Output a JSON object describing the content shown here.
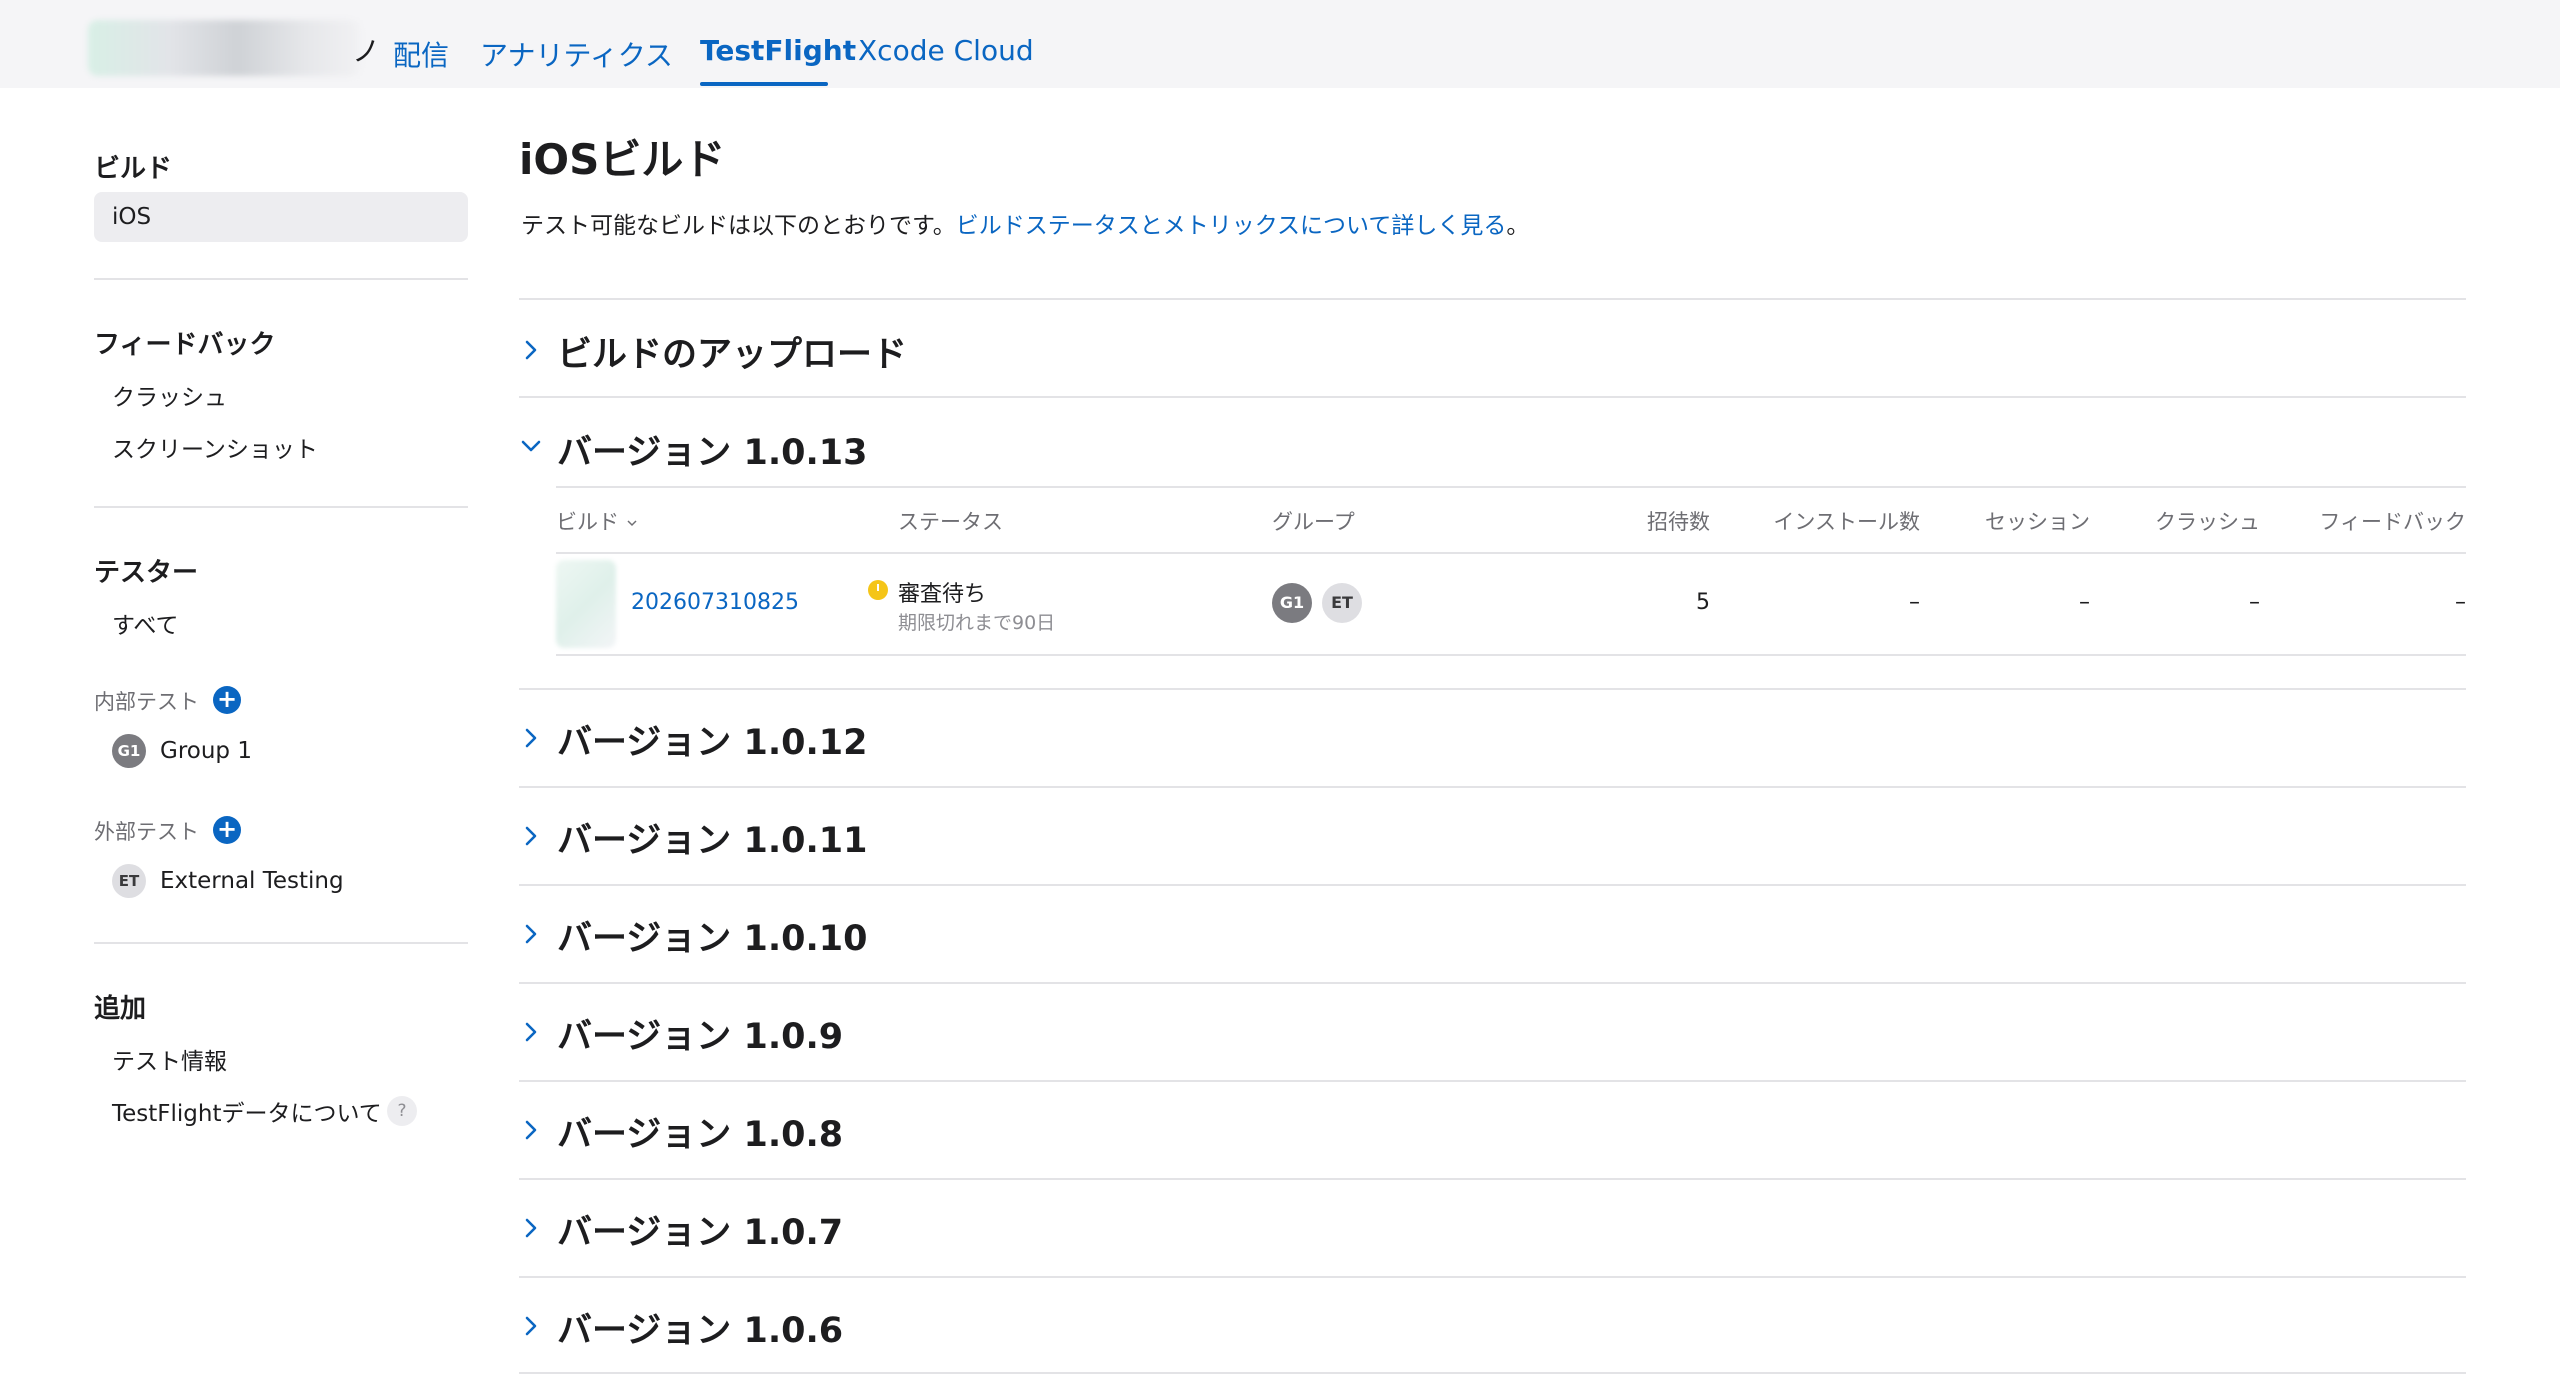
{
  "topnav": {
    "app_name_tail": "ノ",
    "tabs": [
      {
        "label": "配信"
      },
      {
        "label": "アナリティクス"
      },
      {
        "label": "TestFlight"
      },
      {
        "label": "Xcode Cloud"
      }
    ],
    "active_tab": "TestFlight"
  },
  "sidebar": {
    "builds_heading": "ビルド",
    "builds_ios": "iOS",
    "feedback_heading": "フィードバック",
    "feedback_crash": "クラッシュ",
    "feedback_screenshot": "スクリーンショット",
    "testers_heading": "テスター",
    "testers_all": "すべて",
    "internal_label": "内部テスト",
    "internal_group": {
      "initials": "G1",
      "name": "Group 1"
    },
    "external_label": "外部テスト",
    "external_group": {
      "initials": "ET",
      "name": "External Testing"
    },
    "extra_heading": "追加",
    "extra_test_info": "テスト情報",
    "extra_about": "TestFlightデータについて",
    "help_glyph": "?"
  },
  "main": {
    "title": "iOSビルド",
    "desc": "テスト可能なビルドは以下のとおりです。",
    "desc_link": "ビルドステータスとメトリックスについて詳しく見る",
    "desc_end": "。",
    "upload_section": "ビルドのアップロード",
    "expanded_version": "バージョン 1.0.13",
    "table": {
      "headers": {
        "build": "ビルド",
        "status": "ステータス",
        "group": "グループ",
        "invites": "招待数",
        "installs": "インストール数",
        "sessions": "セッション",
        "crashes": "クラッシュ",
        "feedback": "フィードバック"
      },
      "row": {
        "build_number": "202607310825",
        "status": "審査待ち",
        "status_sub": "期限切れまで90日",
        "groups": [
          "G1",
          "ET"
        ],
        "invites": "5",
        "installs": "–",
        "sessions": "–",
        "crashes": "–",
        "feedback": "–"
      }
    },
    "versions": [
      "バージョン 1.0.12",
      "バージョン 1.0.11",
      "バージョン 1.0.10",
      "バージョン 1.0.9",
      "バージョン 1.0.8",
      "バージョン 1.0.7",
      "バージョン 1.0.6"
    ]
  },
  "colors": {
    "accent": "#0a66c2",
    "status_pending": "#f5c518"
  }
}
